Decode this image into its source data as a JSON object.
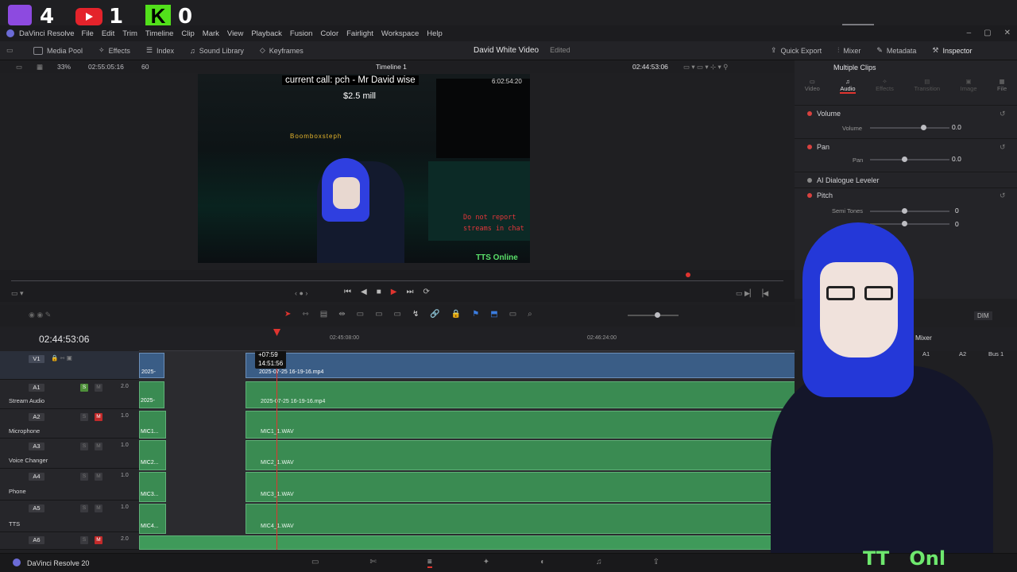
{
  "overlay": {
    "twitch_count": "4",
    "youtube_count": "1",
    "kick_count": "0"
  },
  "app": {
    "name": "DaVinci Resolve",
    "version_label": "DaVinci Resolve 20"
  },
  "menu": [
    "File",
    "Edit",
    "Trim",
    "Timeline",
    "Clip",
    "Mark",
    "View",
    "Playback",
    "Fusion",
    "Color",
    "Fairlight",
    "Workspace",
    "Help"
  ],
  "toolbar": {
    "left": [
      "Media Pool",
      "Effects",
      "Index",
      "Sound Library",
      "Keyframes"
    ],
    "project_title": "David White Video",
    "project_status": "Edited",
    "right": [
      "Quick Export",
      "Mixer",
      "Metadata",
      "Inspector"
    ]
  },
  "viewer": {
    "zoom": "33%",
    "source_tc": "02:55:05:16",
    "fps": "60",
    "timeline_name": "Timeline 1",
    "record_tc": "02:44:53:06",
    "stream_caption": "current call: pch - Mr David wise",
    "stream_amount": "$2.5 mill",
    "stream_tag": "TTS Online",
    "stream_user": "Boomboxsteph",
    "stream_warning": "Do not report streams in chat",
    "stream_time": "6:02:54:20"
  },
  "inspector": {
    "title": "Multiple Clips",
    "tabs": [
      "Video",
      "Audio",
      "Effects",
      "Transition",
      "Image",
      "File"
    ],
    "active_tab": "Audio",
    "sections": [
      {
        "name": "Volume",
        "param": "Volume",
        "value": "0.0"
      },
      {
        "name": "Pan",
        "param": "Pan",
        "value": "0.0"
      },
      {
        "name": "AI Dialogue Leveler"
      },
      {
        "name": "Pitch",
        "param": "Semi Tones",
        "value": "0",
        "value2": "0"
      }
    ]
  },
  "timeline": {
    "timecode": "02:44:53:06",
    "ruler": [
      "02:45:08:00",
      "02:46:24:00"
    ],
    "tooltip_offset": "+07:59",
    "tooltip_tc": "14:51:56",
    "video_clip": "2025-07-25 16-19-16.mp4",
    "video_clip_short": "2025-",
    "tracks": [
      {
        "id": "V1",
        "name": "",
        "vol": ""
      },
      {
        "id": "A1",
        "name": "Stream Audio",
        "vol": "2.0",
        "clip": "2025-07-25 16-19-16.mp4",
        "short": "2025-"
      },
      {
        "id": "A2",
        "name": "Microphone",
        "vol": "1.0",
        "clip": "MIC1_1.WAV",
        "short": "MIC1..."
      },
      {
        "id": "A3",
        "name": "Voice Changer",
        "vol": "1.0",
        "clip": "MIC2_1.WAV",
        "short": "MIC2..."
      },
      {
        "id": "A4",
        "name": "Phone",
        "vol": "1.0",
        "clip": "MIC3_1.WAV",
        "short": "MIC3..."
      },
      {
        "id": "A5",
        "name": "TTS",
        "vol": "1.0",
        "clip": "MIC4_1.WAV",
        "short": "MIC4..."
      },
      {
        "id": "A6",
        "name": "",
        "vol": "2.0"
      }
    ]
  },
  "mixer": {
    "title": "Mixer",
    "channels": [
      "A1",
      "A2",
      "Bus 1"
    ],
    "dim": "DIM"
  },
  "colors": {
    "accent_red": "#e0342f",
    "clip_green": "#3a8b52",
    "clip_blue": "#3a5d86"
  }
}
